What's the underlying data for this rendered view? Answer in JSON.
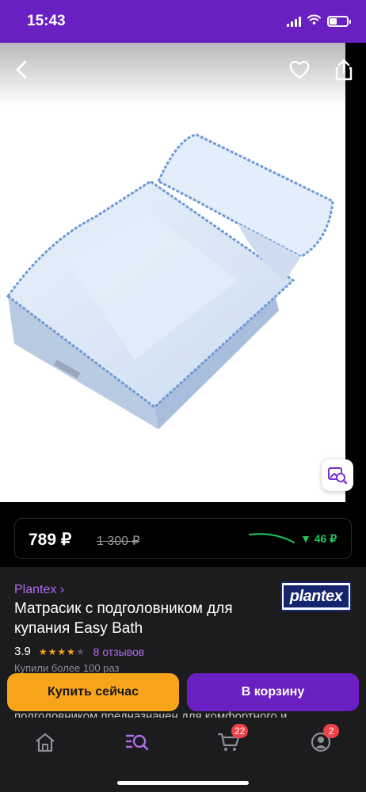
{
  "status": {
    "time": "15:43"
  },
  "product": {
    "seller": "Plantex ›",
    "logo_text": "plantex",
    "title": "Матрасик с подголовником для купания Easy Bath",
    "rating": "3.9",
    "stars_filled": 4,
    "stars_total": 5,
    "reviews": "8 отзывов",
    "bought": "Купили более 100 раз",
    "description_peek": "полголовником предназначен для комфортного и"
  },
  "price": {
    "current": "789 ₽",
    "old": "1 300 ₽",
    "diff": "▼ 46 ₽"
  },
  "actions": {
    "buy_now": "Купить сейчас",
    "add_to_cart": "В корзину"
  },
  "tabbar": {
    "cart_badge": "22",
    "profile_badge": "2"
  },
  "colors": {
    "brand": "#6a1fc2",
    "accent_orange": "#f8a41b",
    "link_purple": "#b06cf0",
    "trend_green": "#22c55e",
    "badge_red": "#f0414a"
  }
}
